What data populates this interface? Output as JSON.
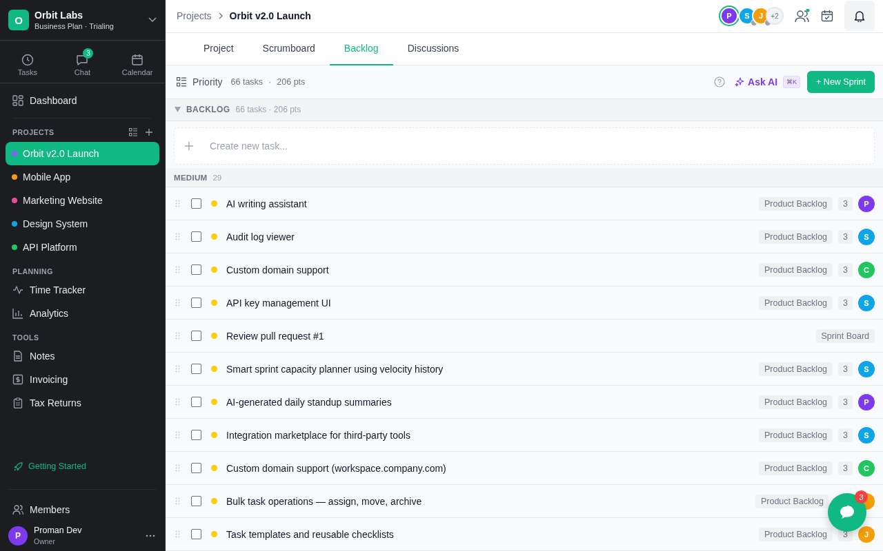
{
  "workspace": {
    "initial": "O",
    "name": "Orbit Labs",
    "plan": "Business Plan · Trialing"
  },
  "nav": [
    {
      "label": "Tasks",
      "kind": "clock"
    },
    {
      "label": "Chat",
      "kind": "chat",
      "badge": "3"
    },
    {
      "label": "Calendar",
      "kind": "calendar"
    }
  ],
  "dashboard": "Dashboard",
  "projects_label": "PROJECTS",
  "projects": [
    {
      "name": "Orbit v2.0 Launch",
      "color": "#8b5cf6",
      "selected": true
    },
    {
      "name": "Mobile App",
      "color": "#f59e0b",
      "selected": false
    },
    {
      "name": "Marketing Website",
      "color": "#ec4899",
      "selected": false
    },
    {
      "name": "Design System",
      "color": "#0ea5e9",
      "selected": false
    },
    {
      "name": "API Platform",
      "color": "#22c55e",
      "selected": false
    }
  ],
  "sections": [
    {
      "label": "PLANNING",
      "items": [
        {
          "label": "Time Tracker",
          "kind": "pulse"
        },
        {
          "label": "Analytics",
          "kind": "chart"
        }
      ]
    },
    {
      "label": "TOOLS",
      "items": [
        {
          "label": "Notes",
          "kind": "doc"
        },
        {
          "label": "Invoicing",
          "kind": "dollar"
        },
        {
          "label": "Tax Returns",
          "kind": "clipboard"
        }
      ]
    }
  ],
  "getting_started": "Getting Started",
  "members": "Members",
  "user": {
    "initial": "P",
    "name": "Proman Dev",
    "role": "Owner"
  },
  "breadcrumb": {
    "parent": "Projects",
    "current": "Orbit v2.0 Launch"
  },
  "header_avatars": [
    {
      "letter": "P",
      "color": "#7c3aed",
      "selected": true,
      "away": false
    },
    {
      "letter": "S",
      "color": "#0ea5e9",
      "selected": false,
      "away": true
    },
    {
      "letter": "J",
      "color": "#f59e0b",
      "selected": false,
      "away": true
    }
  ],
  "header_more": "+2",
  "tabs": [
    {
      "label": "Project",
      "selected": false
    },
    {
      "label": "Scrumboard",
      "selected": false
    },
    {
      "label": "Backlog",
      "selected": true
    },
    {
      "label": "Discussions",
      "selected": false
    }
  ],
  "toolbar": {
    "group_by": "Priority",
    "tasks": "66 tasks",
    "sep": "·",
    "points": "206 pts",
    "ask_ai": "Ask AI",
    "shortcut": "⌘K",
    "new_sprint": "+ New Sprint"
  },
  "backlog": {
    "title": "BACKLOG",
    "summary": "66 tasks · 206 pts",
    "expanded": true
  },
  "create_placeholder": "Create new task...",
  "group": {
    "label": "MEDIUM",
    "count": "29"
  },
  "tasks": [
    {
      "title": "AI writing assistant",
      "checked": false,
      "tag": "Product Backlog",
      "points": "3",
      "avatar": {
        "letter": "P",
        "color": "#7c3aed"
      }
    },
    {
      "title": "Audit log viewer",
      "checked": false,
      "tag": "Product Backlog",
      "points": "3",
      "avatar": {
        "letter": "S",
        "color": "#0ea5e9"
      }
    },
    {
      "title": "Custom domain support",
      "checked": false,
      "tag": "Product Backlog",
      "points": "3",
      "avatar": {
        "letter": "C",
        "color": "#22c55e"
      }
    },
    {
      "title": "API key management UI",
      "checked": false,
      "tag": "Product Backlog",
      "points": "3",
      "avatar": {
        "letter": "S",
        "color": "#0ea5e9"
      }
    },
    {
      "title": "Review pull request #1",
      "checked": false,
      "tag": "Sprint Board"
    },
    {
      "title": "Smart sprint capacity planner using velocity history",
      "checked": false,
      "tag": "Product Backlog",
      "points": "3",
      "avatar": {
        "letter": "S",
        "color": "#0ea5e9"
      }
    },
    {
      "title": "AI-generated daily standup summaries",
      "checked": false,
      "tag": "Product Backlog",
      "points": "3",
      "avatar": {
        "letter": "P",
        "color": "#7c3aed"
      }
    },
    {
      "title": "Integration marketplace for third-party tools",
      "checked": false,
      "tag": "Product Backlog",
      "points": "3",
      "avatar": {
        "letter": "S",
        "color": "#0ea5e9"
      }
    },
    {
      "title": "Custom domain support (workspace.company.com)",
      "checked": false,
      "tag": "Product Backlog",
      "points": "3",
      "avatar": {
        "letter": "C",
        "color": "#22c55e"
      }
    },
    {
      "title": "Bulk task operations — assign, move, archive",
      "checked": false,
      "tag": "Product Backlog",
      "avatar": {
        "color": "#f59e0b"
      }
    },
    {
      "title": "Task templates and reusable checklists",
      "checked": false,
      "tag": "Product Backlog",
      "points": "3",
      "avatar": {
        "letter": "J",
        "color": "#f59e0b"
      }
    }
  ],
  "chat_fab": {
    "badge": "3"
  }
}
